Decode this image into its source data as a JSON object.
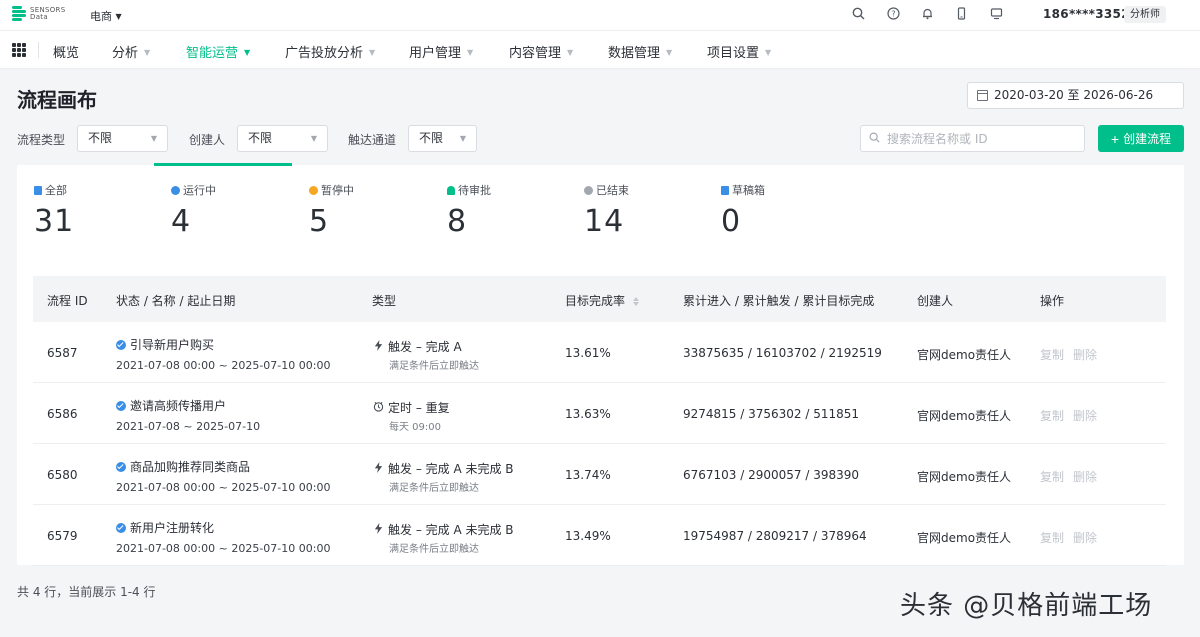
{
  "header": {
    "logo_line1": "SENSORS",
    "logo_line2": "Data",
    "project": "电商",
    "phone": "186****3352",
    "role": "分析师"
  },
  "nav": {
    "items": [
      {
        "label": "概览",
        "dropdown": false
      },
      {
        "label": "分析",
        "dropdown": true
      },
      {
        "label": "智能运营",
        "dropdown": true,
        "active": true
      },
      {
        "label": "广告投放分析",
        "dropdown": true
      },
      {
        "label": "用户管理",
        "dropdown": true
      },
      {
        "label": "内容管理",
        "dropdown": true
      },
      {
        "label": "数据管理",
        "dropdown": true
      },
      {
        "label": "项目设置",
        "dropdown": true
      }
    ]
  },
  "page": {
    "title": "流程画布",
    "date_range": "2020-03-20 至 2026-06-26"
  },
  "filters": {
    "type_label": "流程类型",
    "type_value": "不限",
    "creator_label": "创建人",
    "creator_value": "不限",
    "channel_label": "触达通道",
    "channel_value": "不限",
    "search_placeholder": "搜索流程名称或 ID",
    "create_label": "创建流程"
  },
  "stats": [
    {
      "label": "全部",
      "value": "31",
      "color": "#3a8ee6"
    },
    {
      "label": "运行中",
      "value": "4",
      "color": "#3a8ee6"
    },
    {
      "label": "暂停中",
      "value": "5",
      "color": "#f5a623"
    },
    {
      "label": "待审批",
      "value": "8",
      "color": "#00bf8a"
    },
    {
      "label": "已结束",
      "value": "14",
      "color": "#a3a8b0"
    },
    {
      "label": "草稿箱",
      "value": "0",
      "color": "#3a8ee6"
    }
  ],
  "table": {
    "headers": [
      "流程 ID",
      "状态 / 名称 / 起止日期",
      "类型",
      "目标完成率",
      "累计进入 / 累计触发 / 累计目标完成",
      "创建人",
      "操作"
    ],
    "rows": [
      {
        "id": "6587",
        "name": "引导新用户购买",
        "dates": "2021-07-08 00:00 ~ 2025-07-10 00:00",
        "type": "触发 – 完成 A",
        "type_sub": "满足条件后立即触达",
        "type_icon": "bolt",
        "rate": "13.61%",
        "counts": "33875635 / 16103702 / 2192519",
        "creator": "官网demo责任人",
        "op1": "复制",
        "op2": "删除"
      },
      {
        "id": "6586",
        "name": "邀请高频传播用户",
        "dates": "2021-07-08 ~ 2025-07-10",
        "type": "定时 – 重复",
        "type_sub": "每天 09:00",
        "type_icon": "clock",
        "rate": "13.63%",
        "counts": "9274815 / 3756302 / 511851",
        "creator": "官网demo责任人",
        "op1": "复制",
        "op2": "删除"
      },
      {
        "id": "6580",
        "name": "商品加购推荐同类商品",
        "dates": "2021-07-08 00:00 ~ 2025-07-10 00:00",
        "type": "触发 – 完成 A 未完成 B",
        "type_sub": "满足条件后立即触达",
        "type_icon": "bolt",
        "rate": "13.74%",
        "counts": "6767103 / 2900057 / 398390",
        "creator": "官网demo责任人",
        "op1": "复制",
        "op2": "删除"
      },
      {
        "id": "6579",
        "name": "新用户注册转化",
        "dates": "2021-07-08 00:00 ~ 2025-07-10 00:00",
        "type": "触发 – 完成 A 未完成 B",
        "type_sub": "满足条件后立即触达",
        "type_icon": "bolt",
        "rate": "13.49%",
        "counts": "19754987 / 2809217 / 378964",
        "creator": "官网demo责任人",
        "op1": "复制",
        "op2": "删除"
      }
    ]
  },
  "footer": {
    "info": "共 4 行，当前展示 1-4 行"
  },
  "watermark": "头条 @贝格前端工场",
  "colors": {
    "accent": "#00bf8a",
    "running": "#3a8ee6"
  }
}
